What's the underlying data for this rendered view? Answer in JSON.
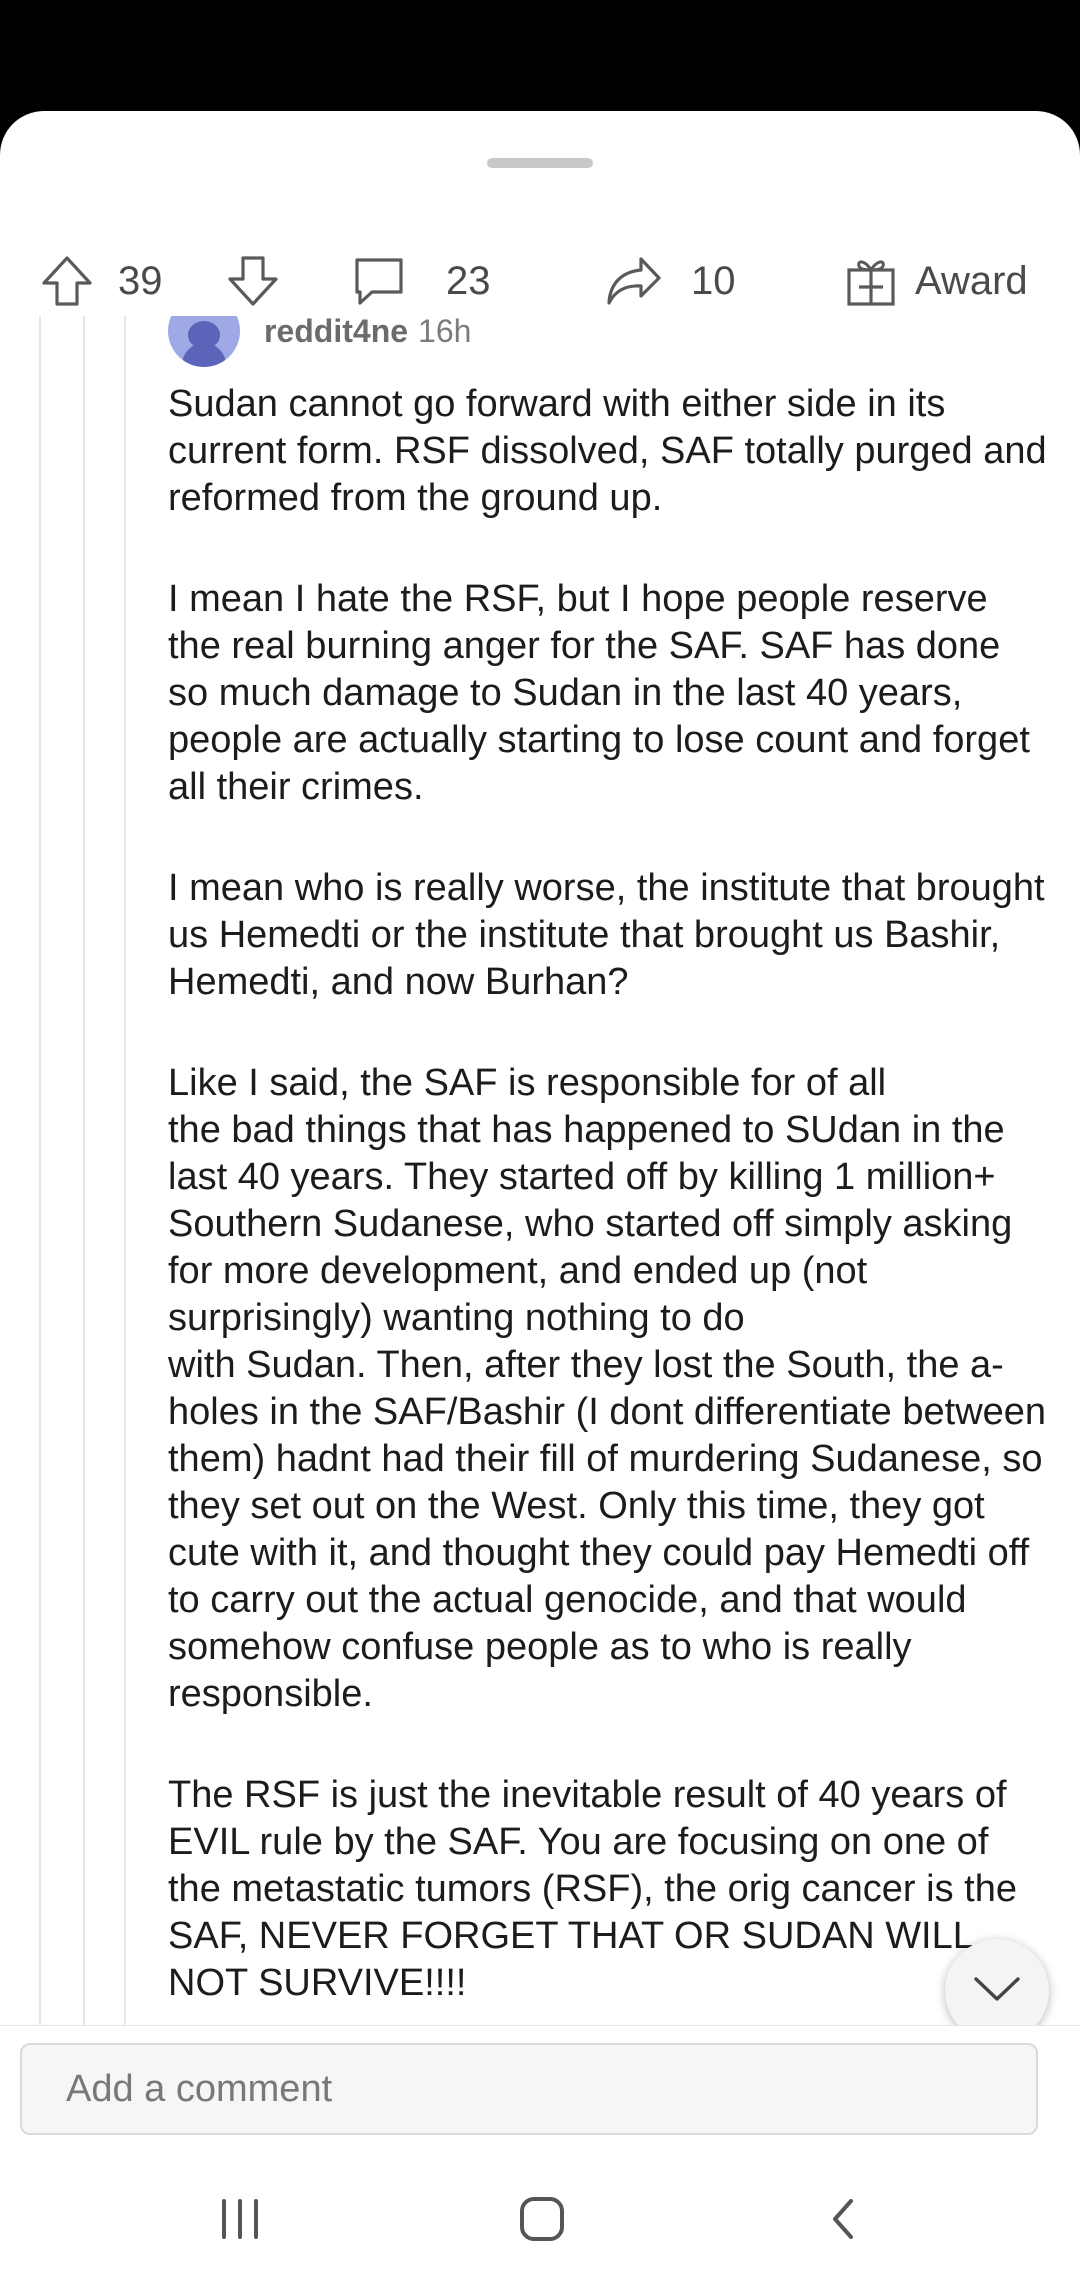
{
  "actions": {
    "upvotes": "39",
    "comments": "23",
    "shares": "10",
    "award_label": "Award"
  },
  "comment": {
    "username": "reddit4ne",
    "age": "16h",
    "paragraphs": [
      "Sudan cannot go forward with either side in its current form.  RSF dissolved, SAF totally purged and reformed from the ground up.",
      "I mean I hate the RSF, but I hope people reserve the real burning anger for the SAF.  SAF has done so much damage to Sudan in the last 40 years, people are actually starting to lose count and forget all their crimes.",
      "I mean who is really worse, the institute that brought us Hemedti or the institute that brought us Bashir, Hemedti, and now Burhan?",
      "Like I said, the SAF is responsible for of all\nthe bad things that has happened to SUdan in the last 40 years.  They started off by killing 1 million+ Southern Sudanese, who started off simply asking for more development, and ended up (not surprisingly) wanting nothing to do\nwith Sudan.  Then, after they lost the South, the a-holes in the SAF/Bashir (I dont differentiate between them) hadnt had their fill of murdering Sudanese, so they set out on the West.  Only this time, they got cute with it, and thought they could pay Hemedti off to carry out the actual genocide, and that would somehow confuse people as to who is really responsible.",
      "The RSF is just the inevitable result of 40 years of EVIL rule by the SAF.  You are focusing on one of the metastatic tumors (RSF), the orig cancer is the SAF, NEVER FORGET THAT OR SUDAN WILL NOT SURVIVE!!!!"
    ]
  },
  "composer": {
    "placeholder": "Add a comment"
  },
  "icons": {
    "upvote": "arrow-up-icon",
    "downvote": "arrow-down-icon",
    "comment": "speech-bubble-icon",
    "share": "share-arrow-icon",
    "award": "gift-icon",
    "scroll": "chevron-down-icon",
    "recents": "recents-icon",
    "home": "home-icon",
    "back": "back-icon"
  },
  "colors": {
    "avatar": "#9ea9e6",
    "background": "#ffffff",
    "status_bar": "#000000"
  }
}
